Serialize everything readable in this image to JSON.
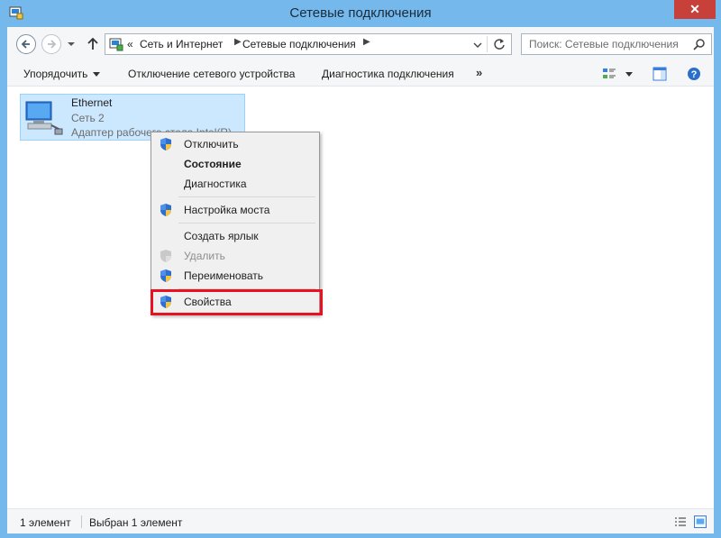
{
  "window": {
    "title": "Сетевые подключения",
    "close_glyph": "✕"
  },
  "address": {
    "prefix": "«",
    "crumbs": [
      "Сеть и Интернет",
      "Сетевые подключения"
    ],
    "search_placeholder": "Поиск: Сетевые подключения"
  },
  "toolbar": {
    "organize_label": "Упорядочить",
    "disable_label": "Отключение сетевого устройства",
    "diagnose_label": "Диагностика подключения",
    "more_label": "»"
  },
  "item": {
    "name": "Ethernet",
    "network": "Сеть  2",
    "adapter": "Адаптер рабочего стола Intel(R)"
  },
  "context_menu": {
    "items": [
      {
        "label": "Отключить",
        "shield": true,
        "bold": false,
        "disabled": false
      },
      {
        "label": "Состояние",
        "shield": false,
        "bold": true,
        "disabled": false
      },
      {
        "label": "Диагностика",
        "shield": false,
        "bold": false,
        "disabled": false
      },
      {
        "label": "Настройка моста",
        "shield": true,
        "bold": false,
        "disabled": false
      },
      {
        "label": "Создать ярлык",
        "shield": false,
        "bold": false,
        "disabled": false
      },
      {
        "label": "Удалить",
        "shield": true,
        "bold": false,
        "disabled": true
      },
      {
        "label": "Переименовать",
        "shield": true,
        "bold": false,
        "disabled": false
      },
      {
        "label": "Свойства",
        "shield": true,
        "bold": false,
        "disabled": false
      }
    ]
  },
  "status": {
    "count": "1 элемент",
    "selected": "Выбран 1 элемент"
  },
  "colors": {
    "frame": "#74b8ec",
    "close": "#c7413a",
    "selection": "#cce8ff",
    "highlight": "#e9101f"
  }
}
